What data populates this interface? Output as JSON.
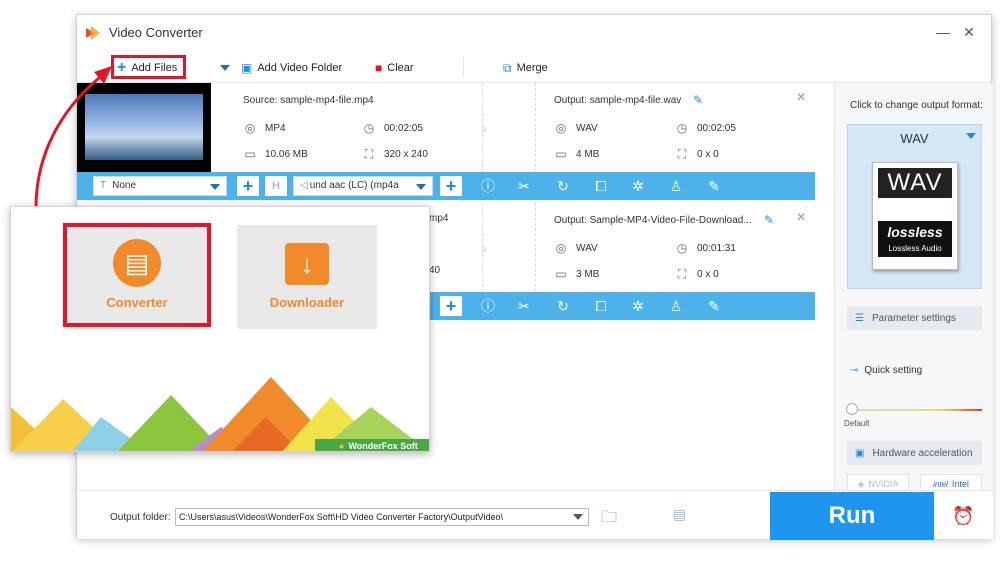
{
  "window": {
    "title": "Video Converter",
    "minimize": "—",
    "close": "✕"
  },
  "toolbar": {
    "add_files": "Add Files",
    "add_video_folder": "Add Video Folder",
    "clear": "Clear",
    "merge": "Merge"
  },
  "files": [
    {
      "source": "Source: sample-mp4-file.mp4",
      "src_format": "MP4",
      "src_duration": "00:02:05",
      "src_size": "10.06 MB",
      "src_resolution": "320 x 240",
      "output": "Output: sample-mp4-file.wav",
      "out_format": "WAV",
      "out_duration": "00:02:05",
      "out_size": "4 MB",
      "out_resolution": "0 x 0",
      "subtitle": "None",
      "audio": "und aac (LC) (mp4a"
    },
    {
      "source_partial": "mp4",
      "src_resolution_partial": "40",
      "output": "Output: Sample-MP4-Video-File-Download...",
      "out_format": "WAV",
      "out_duration": "00:01:31",
      "out_size": "3 MB",
      "out_resolution": "0 x 0"
    }
  ],
  "right_panel": {
    "change_format_label": "Click to change output format:",
    "format": "WAV",
    "wav_badge": "WAV",
    "lossless_title": "lossless",
    "lossless_sub": "Lossless Audio",
    "parameter_settings": "Parameter settings",
    "quick_setting": "Quick setting",
    "slider_default": "Default",
    "hardware_acceleration": "Hardware acceleration",
    "nvidia": "NVIDIA",
    "intel": "Intel"
  },
  "bottom": {
    "output_folder_label": "Output folder:",
    "output_folder_value": "C:\\Users\\asus\\Videos\\WonderFox Soft\\HD Video Converter Factory\\OutputVideo\\",
    "run": "Run"
  },
  "popup": {
    "converter": "Converter",
    "downloader": "Downloader",
    "brand": "WonderFox Soft"
  },
  "colors": {
    "accent": "#1e95ee",
    "highlight": "#e2162b",
    "tile_orange": "#f08a2a"
  }
}
